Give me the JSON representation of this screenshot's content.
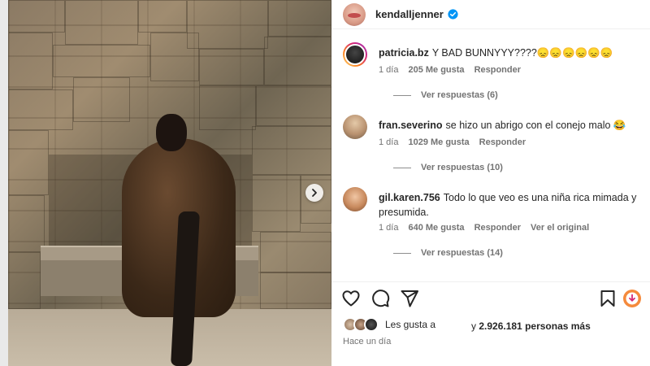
{
  "post": {
    "author": "kendalljenner",
    "verified": true
  },
  "comments": [
    {
      "user": "patricia.bz",
      "text": "Y BAD BUNNYYY????😞😞😞😞😞😞",
      "time": "1 día",
      "likes": "205 Me gusta",
      "reply": "Responder",
      "view_replies": "Ver respuestas (6)"
    },
    {
      "user": "fran.severino",
      "text": "se hizo un abrigo con el conejo malo 😂",
      "time": "1 día",
      "likes": "1029 Me gusta",
      "reply": "Responder",
      "view_replies": "Ver respuestas (10)"
    },
    {
      "user": "gil.karen.756",
      "text": "Todo lo que veo es una niña rica mimada y presumida.",
      "time": "1 día",
      "likes": "640 Me gusta",
      "reply": "Responder",
      "see_original": "Ver el original",
      "view_replies": "Ver respuestas (14)"
    }
  ],
  "likes": {
    "prefix": "Les gusta a",
    "suffix_pre": "y",
    "count": "2.926.181 personas más"
  },
  "timestamp": "Hace un día",
  "icons": {
    "like": "heart-icon",
    "comment": "comment-bubble-icon",
    "share": "paper-plane-icon",
    "save": "bookmark-icon",
    "extra": "download-badge-icon",
    "next": "chevron-right-icon"
  },
  "colors": {
    "verified_blue": "#0095f6",
    "story_ring_start": "#feda75",
    "story_ring_end": "#d62976",
    "extra_badge": "#f58a3c"
  }
}
